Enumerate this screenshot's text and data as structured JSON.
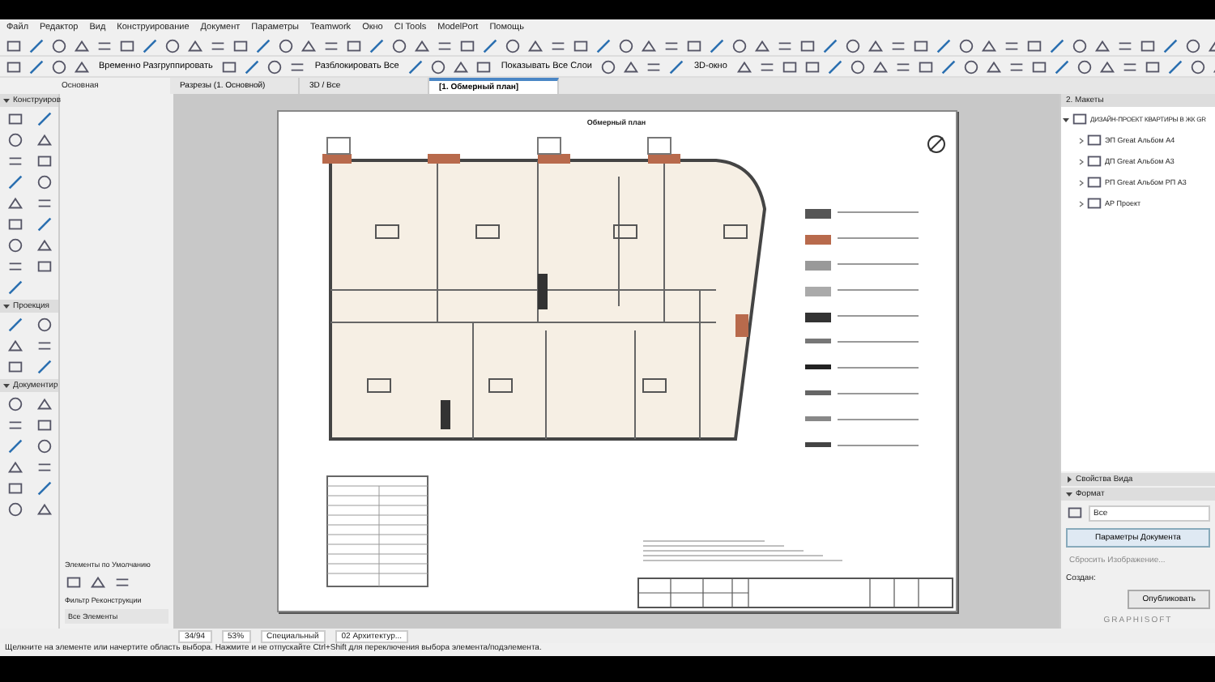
{
  "menu": [
    "Файл",
    "Редактор",
    "Вид",
    "Конструирование",
    "Документ",
    "Параметры",
    "Teamwork",
    "Окно",
    "CI Tools",
    "ModelPort",
    "Помощь"
  ],
  "toolbar2_labels": [
    "Временно Разгруппировать",
    "Разблокировать Все",
    "Показывать Все Слои",
    "3D-окно"
  ],
  "info_box": {
    "label": "Основная"
  },
  "tabs": [
    {
      "label": "Разрезы (1. Основной)",
      "selected": false
    },
    {
      "label": "3D / Все",
      "selected": false
    },
    {
      "label": "[1. Обмерный план]",
      "selected": true
    }
  ],
  "toolbox": [
    {
      "title": "Конструиров",
      "expanded": true
    },
    {
      "title": "Проекция",
      "expanded": true
    },
    {
      "title": "Документир",
      "expanded": true
    }
  ],
  "defaults": {
    "title": "Элементы по Умолчанию",
    "filter_title": "Фильтр Реконструкции",
    "filter_value": "Все Элементы"
  },
  "sheet": {
    "title": "Обмерный план"
  },
  "navigator": {
    "title": "2. Макеты",
    "root": {
      "label": "ДИЗАЙН-ПРОЕКТ КВАРТИРЫ В ЖК GR",
      "expanded": true,
      "children": [
        {
          "label": "ЭП Great Альбом А4"
        },
        {
          "label": "ДП Great Альбом А3"
        },
        {
          "label": "РП Great Альбом РП А3"
        },
        {
          "label": "АР Проект"
        }
      ]
    }
  },
  "properties": {
    "sections": [
      {
        "title": "Свойства Вида",
        "expanded": false
      },
      {
        "title": "Формат",
        "expanded": true
      }
    ],
    "format_value": "Все",
    "primary_button": "Параметры Документа",
    "secondary_button": "Сбросить Изображение...",
    "created_label": "Создан:",
    "publish_button": "Опубликовать",
    "logo": "GRAPHISOFT"
  },
  "status_bar": {
    "page": "34/94",
    "zoom": "53%",
    "mode": "Специальный",
    "layer": "02 Архитектур..."
  },
  "hint": "Щелкните на элементе или начертите область выбора. Нажмите и не отпускайте Ctrl+Shift для переключения выбора элемента/подэлемента."
}
